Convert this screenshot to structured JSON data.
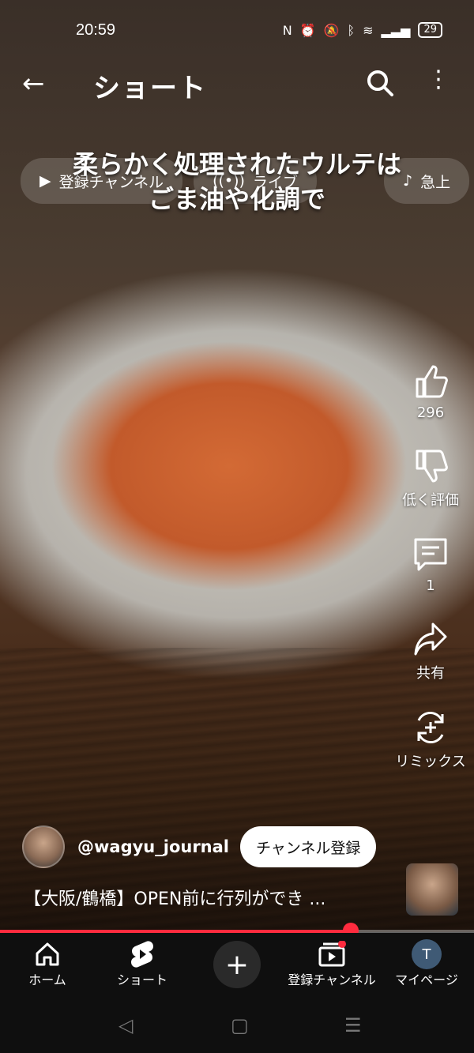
{
  "status": {
    "time": "20:59",
    "battery": "29"
  },
  "topbar": {
    "title": "ショート"
  },
  "chips": [
    {
      "label": "登録チャンネル"
    },
    {
      "label": "ライブ"
    },
    {
      "label": "急上"
    }
  ],
  "caption": {
    "line1": "柔らかく処理されたウルテは",
    "line2": "ごま油や化調で"
  },
  "actions": {
    "likes": "296",
    "dislike": "低く評価",
    "comments": "1",
    "share": "共有",
    "remix": "リミックス"
  },
  "channel": {
    "handle": "@wagyu_journal",
    "subscribe": "チャンネル登録"
  },
  "video": {
    "title": "【大阪/鶴橋】OPEN前に行列ができ ...",
    "progress": 0.74
  },
  "nav": {
    "home": "ホーム",
    "shorts": "ショート",
    "subs": "登録チャンネル",
    "me": "マイページ",
    "me_initial": "T"
  },
  "colors": {
    "accent": "#ff2b3e"
  }
}
